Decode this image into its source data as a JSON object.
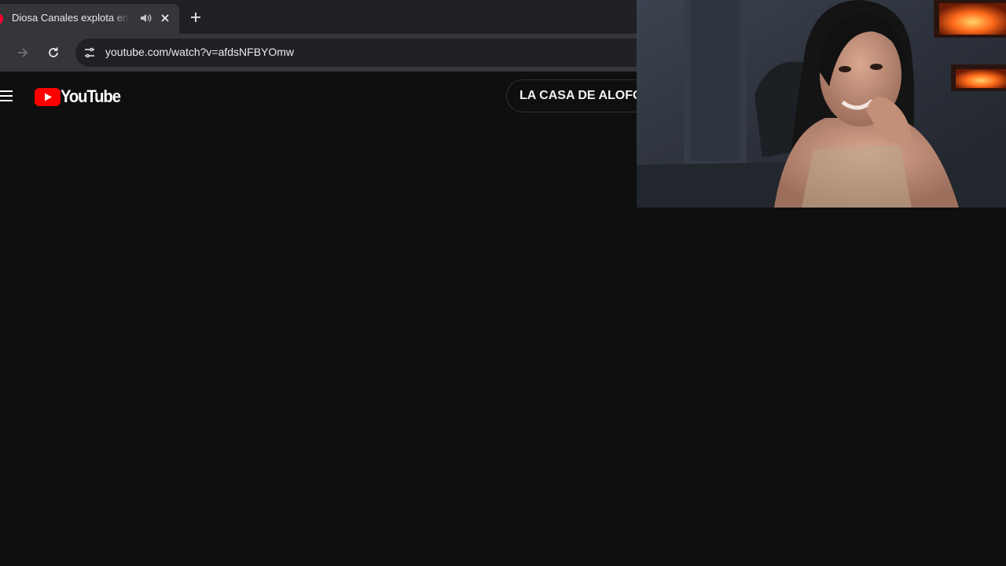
{
  "browser": {
    "tab": {
      "title": "Diosa Canales explota en co",
      "favicon": "youtube-favicon",
      "audio_icon": "speaker-icon",
      "close_icon": "close-icon"
    },
    "new_tab_icon": "plus-icon",
    "toolbar": {
      "forward_icon": "arrow-right-icon",
      "reload_icon": "reload-icon",
      "site_info_icon": "tune-icon",
      "url": "youtube.com/watch?v=afdsNFBYOmw"
    }
  },
  "youtube": {
    "menu_icon": "hamburger-icon",
    "logo_text": "YouTube",
    "channel_chip_label": "LA CASA DE ALOFO"
  },
  "webcam_overlay": {
    "description_icon": "webcam-feed"
  },
  "colors": {
    "background": "#0f0f0f",
    "tabstrip": "#202124",
    "toolbar": "#35363a",
    "youtube_red": "#ff0000"
  }
}
